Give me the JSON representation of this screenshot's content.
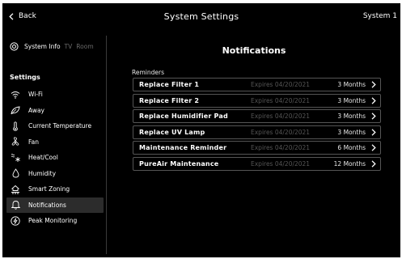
{
  "header": {
    "back_label": "Back",
    "title": "System Settings",
    "system_label": "System 1"
  },
  "sidebar": {
    "tabs": [
      {
        "label": "System Info",
        "icon": "settings-circle-icon",
        "active": true
      },
      {
        "label": "TV",
        "active": false
      },
      {
        "label": "Room",
        "active": false
      }
    ],
    "settings_header": "Settings",
    "items": [
      {
        "label": "Wi-Fi",
        "icon": "wifi-icon"
      },
      {
        "label": "Away",
        "icon": "leaf-icon"
      },
      {
        "label": "Current Temperature",
        "icon": "thermometer-icon"
      },
      {
        "label": "Fan",
        "icon": "fan-icon"
      },
      {
        "label": "Heat/Cool",
        "icon": "heat-cool-icon"
      },
      {
        "label": "Humidity",
        "icon": "droplet-icon"
      },
      {
        "label": "Smart Zoning",
        "icon": "zoning-icon"
      },
      {
        "label": "Notifications",
        "icon": "bell-icon",
        "active": true
      },
      {
        "label": "Peak Monitoring",
        "icon": "lightning-icon"
      }
    ]
  },
  "main": {
    "title": "Notifications",
    "section_label": "Reminders",
    "reminders": [
      {
        "label": "Replace Filter 1",
        "expires": "Expires 04/20/2021",
        "interval": "3 Months"
      },
      {
        "label": "Replace Filter 2",
        "expires": "Expires 04/20/2021",
        "interval": "3 Months"
      },
      {
        "label": "Replace Humidifier Pad",
        "expires": "Expires 04/20/2021",
        "interval": "3 Months"
      },
      {
        "label": "Replace UV Lamp",
        "expires": "Expires 04/20/2021",
        "interval": "3 Months"
      },
      {
        "label": "Maintenance Reminder",
        "expires": "Expires 04/20/2021",
        "interval": "6 Months"
      },
      {
        "label": "PureAir Maintenance",
        "expires": "Expires 04/20/2021",
        "interval": "12 Months"
      }
    ]
  },
  "colors": {
    "background": "#000000",
    "text": "#ffffff",
    "muted_text": "#555555",
    "row_border": "#555555",
    "active_item_bg": "#2c2c2c"
  }
}
